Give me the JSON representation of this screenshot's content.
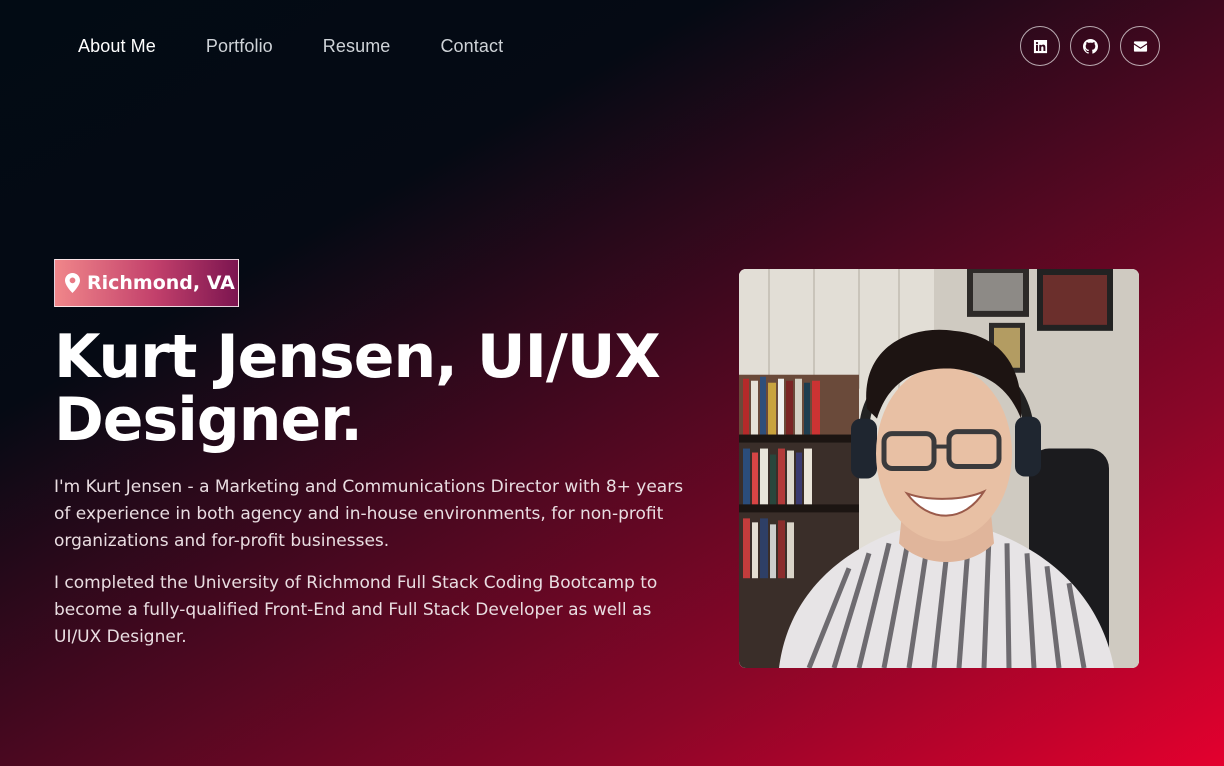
{
  "nav": {
    "links": [
      {
        "label": "About Me",
        "active": true
      },
      {
        "label": "Portfolio",
        "active": false
      },
      {
        "label": "Resume",
        "active": false
      },
      {
        "label": "Contact",
        "active": false
      }
    ],
    "socials": [
      {
        "icon": "linkedin-icon"
      },
      {
        "icon": "github-icon"
      },
      {
        "icon": "envelope-icon"
      }
    ]
  },
  "hero": {
    "location": "Richmond, VA",
    "location_icon": "map-pin-icon",
    "headline": "Kurt Jensen, UI/UX Designer.",
    "bio_1": "I'm Kurt Jensen - a Marketing and Communications Director with 8+ years of experience in both agency and in-house environments, for non-profit organizations and for-profit businesses.",
    "bio_2": "I completed the University of Richmond Full Stack Coding Bootcamp to become a fully-qualified Front-End and Full Stack Developer as well as UI/UX Designer."
  },
  "colors": {
    "background_dark": "#020b14",
    "background_accent": "#e4002e",
    "badge_start": "#f0868a",
    "badge_end": "#7c1550"
  }
}
